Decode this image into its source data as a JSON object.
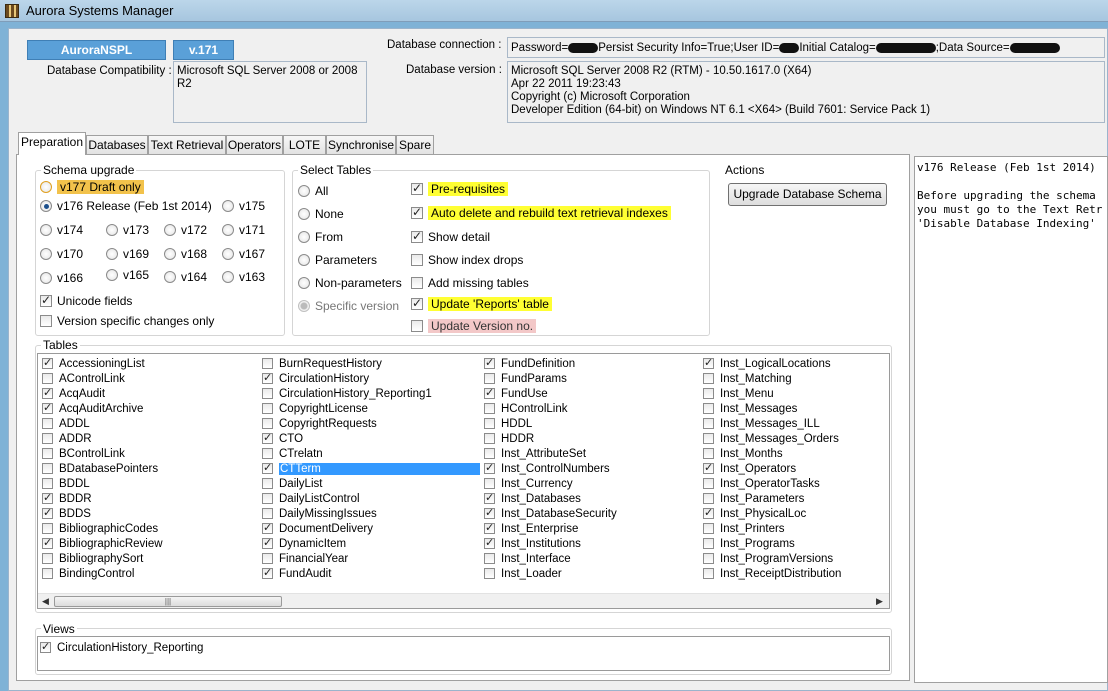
{
  "window": {
    "title": "Aurora Systems Manager"
  },
  "db": {
    "name": "AuroraNSPL",
    "version": "v.171",
    "compat_label": "Database Compatibility :",
    "compat_value": "Microsoft SQL Server 2008 or 2008 R2",
    "conn_label": "Database connection :",
    "conn_parts": [
      "Password=",
      "Persist Security Info=True;User ID=",
      "Initial Catalog=",
      ";Data Source="
    ],
    "version_label": "Database version :",
    "version_lines": [
      "Microsoft SQL Server 2008 R2 (RTM) - 10.50.1617.0 (X64)",
      "Apr 22 2011 19:23:43",
      "Copyright (c) Microsoft Corporation",
      "Developer Edition (64-bit) on Windows NT 6.1 <X64> (Build 7601: Service Pack 1)"
    ]
  },
  "tabs": [
    "Preparation",
    "Databases",
    "Text Retrieval",
    "Operators",
    "LOTE",
    "Synchronise",
    "Spare"
  ],
  "schema": {
    "title": "Schema upgrade",
    "draft": "v177 Draft only",
    "release": "v176 Release (Feb 1st 2014)",
    "v175": "v175",
    "grid": [
      "v174",
      "v173",
      "v172",
      "v171",
      "v170",
      "v169",
      "v168",
      "v167",
      "v166",
      "v165",
      "v164",
      "v163"
    ],
    "unicode": "Unicode fields",
    "version_specific": "Version specific changes only"
  },
  "select": {
    "title": "Select Tables",
    "radios": [
      "All",
      "None",
      "From",
      "Parameters",
      "Non-parameters",
      "Specific version"
    ],
    "checks": [
      {
        "label": "Pre-requisites",
        "checked": true,
        "hl": "yellow"
      },
      {
        "label": "Auto delete and rebuild text retrieval indexes",
        "checked": true,
        "hl": "yellow"
      },
      {
        "label": "Show detail",
        "checked": true,
        "hl": ""
      },
      {
        "label": "Show index drops",
        "checked": false,
        "hl": ""
      },
      {
        "label": "Add missing tables",
        "checked": false,
        "hl": ""
      },
      {
        "label": "Update 'Reports' table",
        "checked": true,
        "hl": "yellow"
      },
      {
        "label": "Update Version no.",
        "checked": false,
        "hl": "pink"
      }
    ]
  },
  "actions": {
    "title": "Actions",
    "button": "Upgrade Database Schema"
  },
  "tables": {
    "title": "Tables",
    "columns": [
      [
        [
          "AccessioningList",
          1
        ],
        [
          "AControlLink",
          0
        ],
        [
          "AcqAudit",
          1
        ],
        [
          "AcqAuditArchive",
          1
        ],
        [
          "ADDL",
          0
        ],
        [
          "ADDR",
          0
        ],
        [
          "BControlLink",
          0
        ],
        [
          "BDatabasePointers",
          0
        ],
        [
          "BDDL",
          0
        ],
        [
          "BDDR",
          1
        ],
        [
          "BDDS",
          1
        ],
        [
          "BibliographicCodes",
          0
        ],
        [
          "BibliographicReview",
          1
        ],
        [
          "BibliographySort",
          0
        ],
        [
          "BindingControl",
          0
        ]
      ],
      [
        [
          "BurnRequestHistory",
          0
        ],
        [
          "CirculationHistory",
          1
        ],
        [
          "CirculationHistory_Reporting1",
          0
        ],
        [
          "CopyrightLicense",
          0
        ],
        [
          "CopyrightRequests",
          0
        ],
        [
          "CTO",
          1
        ],
        [
          "CTrelatn",
          0
        ],
        [
          "CTTerm",
          1
        ],
        [
          "DailyList",
          0
        ],
        [
          "DailyListControl",
          0
        ],
        [
          "DailyMissingIssues",
          0
        ],
        [
          "DocumentDelivery",
          1
        ],
        [
          "DynamicItem",
          1
        ],
        [
          "FinancialYear",
          0
        ],
        [
          "FundAudit",
          1
        ]
      ],
      [
        [
          "FundDefinition",
          1
        ],
        [
          "FundParams",
          0
        ],
        [
          "FundUse",
          1
        ],
        [
          "HControlLink",
          0
        ],
        [
          "HDDL",
          0
        ],
        [
          "HDDR",
          0
        ],
        [
          "Inst_AttributeSet",
          0
        ],
        [
          "Inst_ControlNumbers",
          1
        ],
        [
          "Inst_Currency",
          0
        ],
        [
          "Inst_Databases",
          1
        ],
        [
          "Inst_DatabaseSecurity",
          1
        ],
        [
          "Inst_Enterprise",
          1
        ],
        [
          "Inst_Institutions",
          1
        ],
        [
          "Inst_Interface",
          0
        ],
        [
          "Inst_Loader",
          0
        ]
      ],
      [
        [
          "Inst_LogicalLocations",
          1
        ],
        [
          "Inst_Matching",
          0
        ],
        [
          "Inst_Menu",
          0
        ],
        [
          "Inst_Messages",
          0
        ],
        [
          "Inst_Messages_ILL",
          0
        ],
        [
          "Inst_Messages_Orders",
          0
        ],
        [
          "Inst_Months",
          0
        ],
        [
          "Inst_Operators",
          1
        ],
        [
          "Inst_OperatorTasks",
          0
        ],
        [
          "Inst_Parameters",
          0
        ],
        [
          "Inst_PhysicalLoc",
          1
        ],
        [
          "Inst_Printers",
          0
        ],
        [
          "Inst_Programs",
          0
        ],
        [
          "Inst_ProgramVersions",
          0
        ],
        [
          "Inst_ReceiptDistribution",
          0
        ]
      ]
    ],
    "selected": "CTTerm"
  },
  "views": {
    "title": "Views",
    "items": [
      [
        "CirculationHistory_Reporting",
        1
      ]
    ]
  },
  "log": {
    "lines": [
      "v176 Release (Feb 1st 2014)",
      "",
      "Before upgrading the schema",
      "you must go to the Text Retr",
      "'Disable Database Indexing'"
    ]
  }
}
